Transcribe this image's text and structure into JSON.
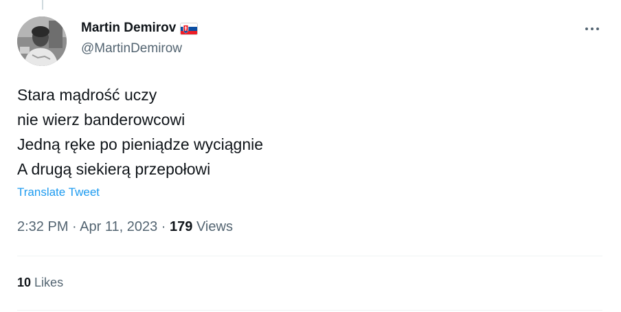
{
  "author": {
    "display_name": "Martin Demirov",
    "handle": "@MartinDemirow",
    "flag_icon": "slovakia-flag-icon"
  },
  "tweet": {
    "lines": [
      "Stara mądrość uczy",
      "nie wierz banderowcowi",
      "Jedną ręke po pieniądze wyciągnie",
      "A drugą siekierą przepołowi"
    ],
    "translate_label": "Translate Tweet"
  },
  "meta": {
    "time": "2:32 PM",
    "separator": "·",
    "date": "Apr 11, 2023",
    "views_count": "179",
    "views_label": "Views"
  },
  "engagement": {
    "likes_count": "10",
    "likes_label": "Likes"
  },
  "colors": {
    "primary_text": "#0f1419",
    "secondary_text": "#536471",
    "link": "#1d9bf0",
    "divider": "#eff3f4"
  }
}
